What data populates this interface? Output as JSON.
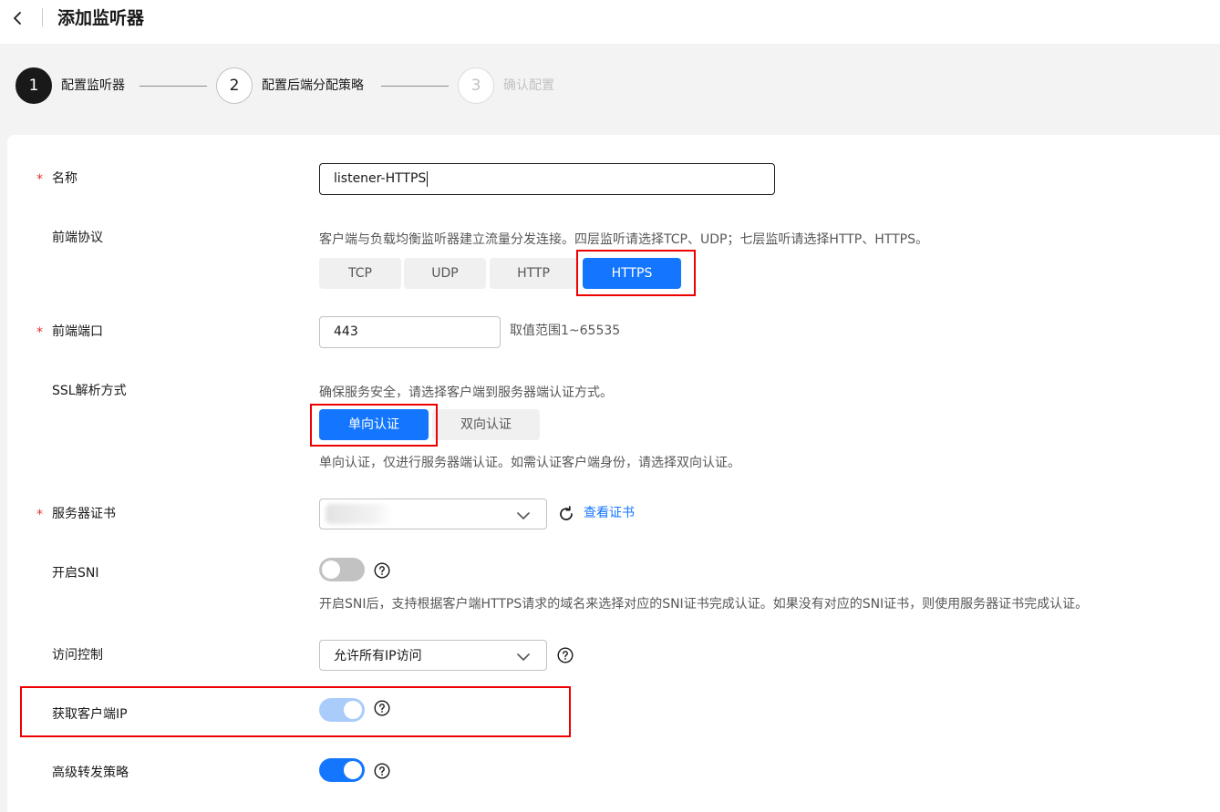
{
  "header": {
    "title": "添加监听器",
    "back_icon": "chevron-left-icon"
  },
  "steps": [
    {
      "number": "1",
      "label": "配置监听器",
      "state": "active"
    },
    {
      "number": "2",
      "label": "配置后端分配策略",
      "state": "pending"
    },
    {
      "number": "3",
      "label": "确认配置",
      "state": "disabled"
    }
  ],
  "form": {
    "name": {
      "label": "名称",
      "required": "*",
      "value": "listener-HTTPS"
    },
    "protocol": {
      "label": "前端协议",
      "hint": "客户端与负载均衡监听器建立流量分发连接。四层监听请选择TCP、UDP；七层监听请选择HTTP、HTTPS。",
      "options": [
        "TCP",
        "UDP",
        "HTTP",
        "HTTPS"
      ],
      "selected": "HTTPS"
    },
    "port": {
      "label": "前端端口",
      "required": "*",
      "value": "443",
      "range_hint": "取值范围1~65535"
    },
    "ssl": {
      "label": "SSL解析方式",
      "hint": "确保服务安全，请选择客户端到服务器端认证方式。",
      "options": [
        "单向认证",
        "双向认证"
      ],
      "selected": "单向认证",
      "note": "单向认证，仅进行服务器端认证。如需认证客户端身份，请选择双向认证。"
    },
    "cert": {
      "label": "服务器证书",
      "required": "*",
      "view_link": "查看证书"
    },
    "sni": {
      "label": "开启SNI",
      "enabled": false,
      "note": "开启SNI后，支持根据客户端HTTPS请求的域名来选择对应的SNI证书完成认证。如果没有对应的SNI证书，则使用服务器证书完成认证。"
    },
    "access": {
      "label": "访问控制",
      "value": "允许所有IP访问"
    },
    "client_ip": {
      "label": "获取客户端IP",
      "enabled": true,
      "disabled": true
    },
    "advanced": {
      "label": "高级转发策略",
      "enabled": true
    }
  },
  "colors": {
    "accent": "#1476ff",
    "required": "#e2302c",
    "highlight_box": "#e00000"
  }
}
